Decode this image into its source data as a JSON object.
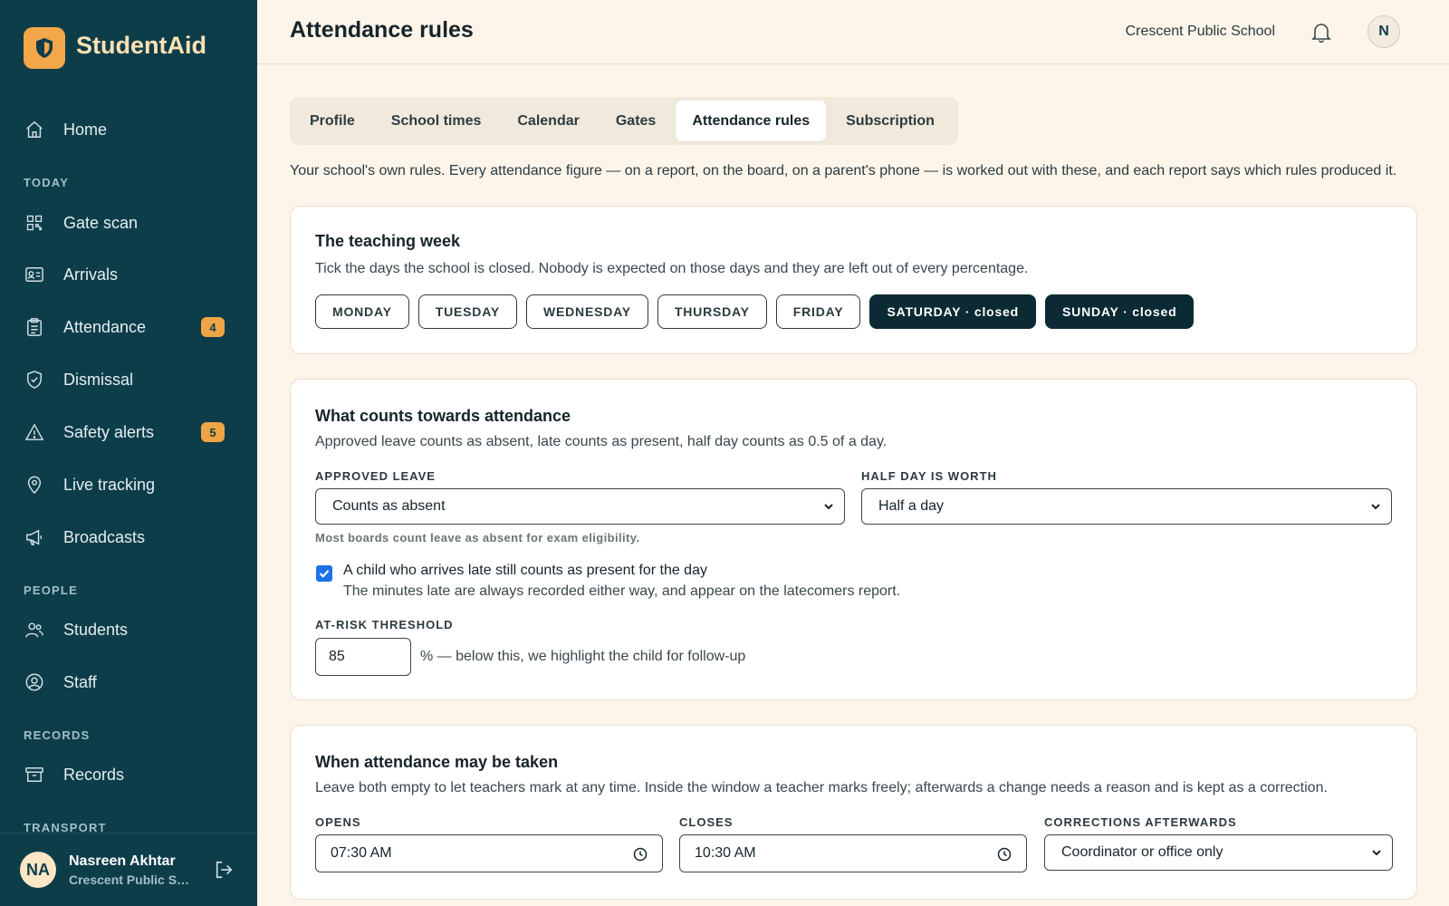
{
  "app": {
    "brand": "StudentAid",
    "colors": {
      "sidebar": "#0e3d4a",
      "brand_accent": "#f3a64a",
      "badge": "#f0a545",
      "background": "#fdf5ea",
      "closed_day": "#0b2a33"
    }
  },
  "sidebar": {
    "items": {
      "home": {
        "label": "Home",
        "icon": "home-icon"
      },
      "gate_scan": {
        "label": "Gate scan",
        "icon": "qr-code-icon"
      },
      "arrivals": {
        "label": "Arrivals",
        "icon": "id-card-icon"
      },
      "attendance": {
        "label": "Attendance",
        "icon": "clipboard-icon",
        "badge": "4"
      },
      "dismissal": {
        "label": "Dismissal",
        "icon": "shield-check-icon"
      },
      "safety_alerts": {
        "label": "Safety alerts",
        "icon": "warning-icon",
        "badge": "5"
      },
      "live_tracking": {
        "label": "Live tracking",
        "icon": "location-pin-icon"
      },
      "broadcasts": {
        "label": "Broadcasts",
        "icon": "megaphone-icon"
      },
      "students": {
        "label": "Students",
        "icon": "users-icon"
      },
      "staff": {
        "label": "Staff",
        "icon": "user-circle-icon"
      },
      "records": {
        "label": "Records",
        "icon": "archive-icon"
      }
    },
    "sections": {
      "today": "TODAY",
      "people": "PEOPLE",
      "records": "RECORDS",
      "transport": "TRANSPORT"
    },
    "user": {
      "initials": "NA",
      "name": "Nasreen Akhtar",
      "school": "Crescent Public School"
    }
  },
  "header": {
    "title": "Attendance rules",
    "school": "Crescent Public School",
    "avatar": "N"
  },
  "tabs": {
    "profile": "Profile",
    "school_times": "School times",
    "calendar": "Calendar",
    "gates": "Gates",
    "attendance_rules": "Attendance rules",
    "subscription": "Subscription",
    "active": "Attendance rules"
  },
  "intro": "Your school's own rules. Every attendance figure — on a report, on the board, on a parent's phone — is worked out with these, and each report says which rules produced it.",
  "teaching_week": {
    "title": "The teaching week",
    "description": "Tick the days the school is closed. Nobody is expected on those days and they are left out of every percentage.",
    "days": {
      "monday": "MONDAY",
      "tuesday": "TUESDAY",
      "wednesday": "WEDNESDAY",
      "thursday": "THURSDAY",
      "friday": "FRIDAY",
      "saturday": "SATURDAY · closed",
      "sunday": "SUNDAY · closed"
    }
  },
  "counts": {
    "title": "What counts towards attendance",
    "description": "Approved leave counts as absent, late counts as present, half day counts as 0.5 of a day.",
    "approved_leave": {
      "label": "APPROVED LEAVE",
      "value": "Counts as absent",
      "hint": "Most boards count leave as absent for exam eligibility."
    },
    "half_day": {
      "label": "HALF DAY IS WORTH",
      "value": "Half a day"
    },
    "late_present": {
      "checked": true,
      "label": "A child who arrives late still counts as present for the day",
      "sub": "The minutes late are always recorded either way, and appear on the latecomers report."
    },
    "at_risk": {
      "label": "AT-RISK THRESHOLD",
      "value": "85",
      "suffix": "% — below this, we highlight the child for follow-up"
    }
  },
  "window": {
    "title": "When attendance may be taken",
    "description": "Leave both empty to let teachers mark at any time. Inside the window a teacher marks freely; afterwards a change needs a reason and is kept as a correction.",
    "opens": {
      "label": "OPENS",
      "value": "07:30 AM"
    },
    "closes": {
      "label": "CLOSES",
      "value": "10:30 AM"
    },
    "corrections": {
      "label": "CORRECTIONS AFTERWARDS",
      "value": "Coordinator or office only"
    }
  }
}
